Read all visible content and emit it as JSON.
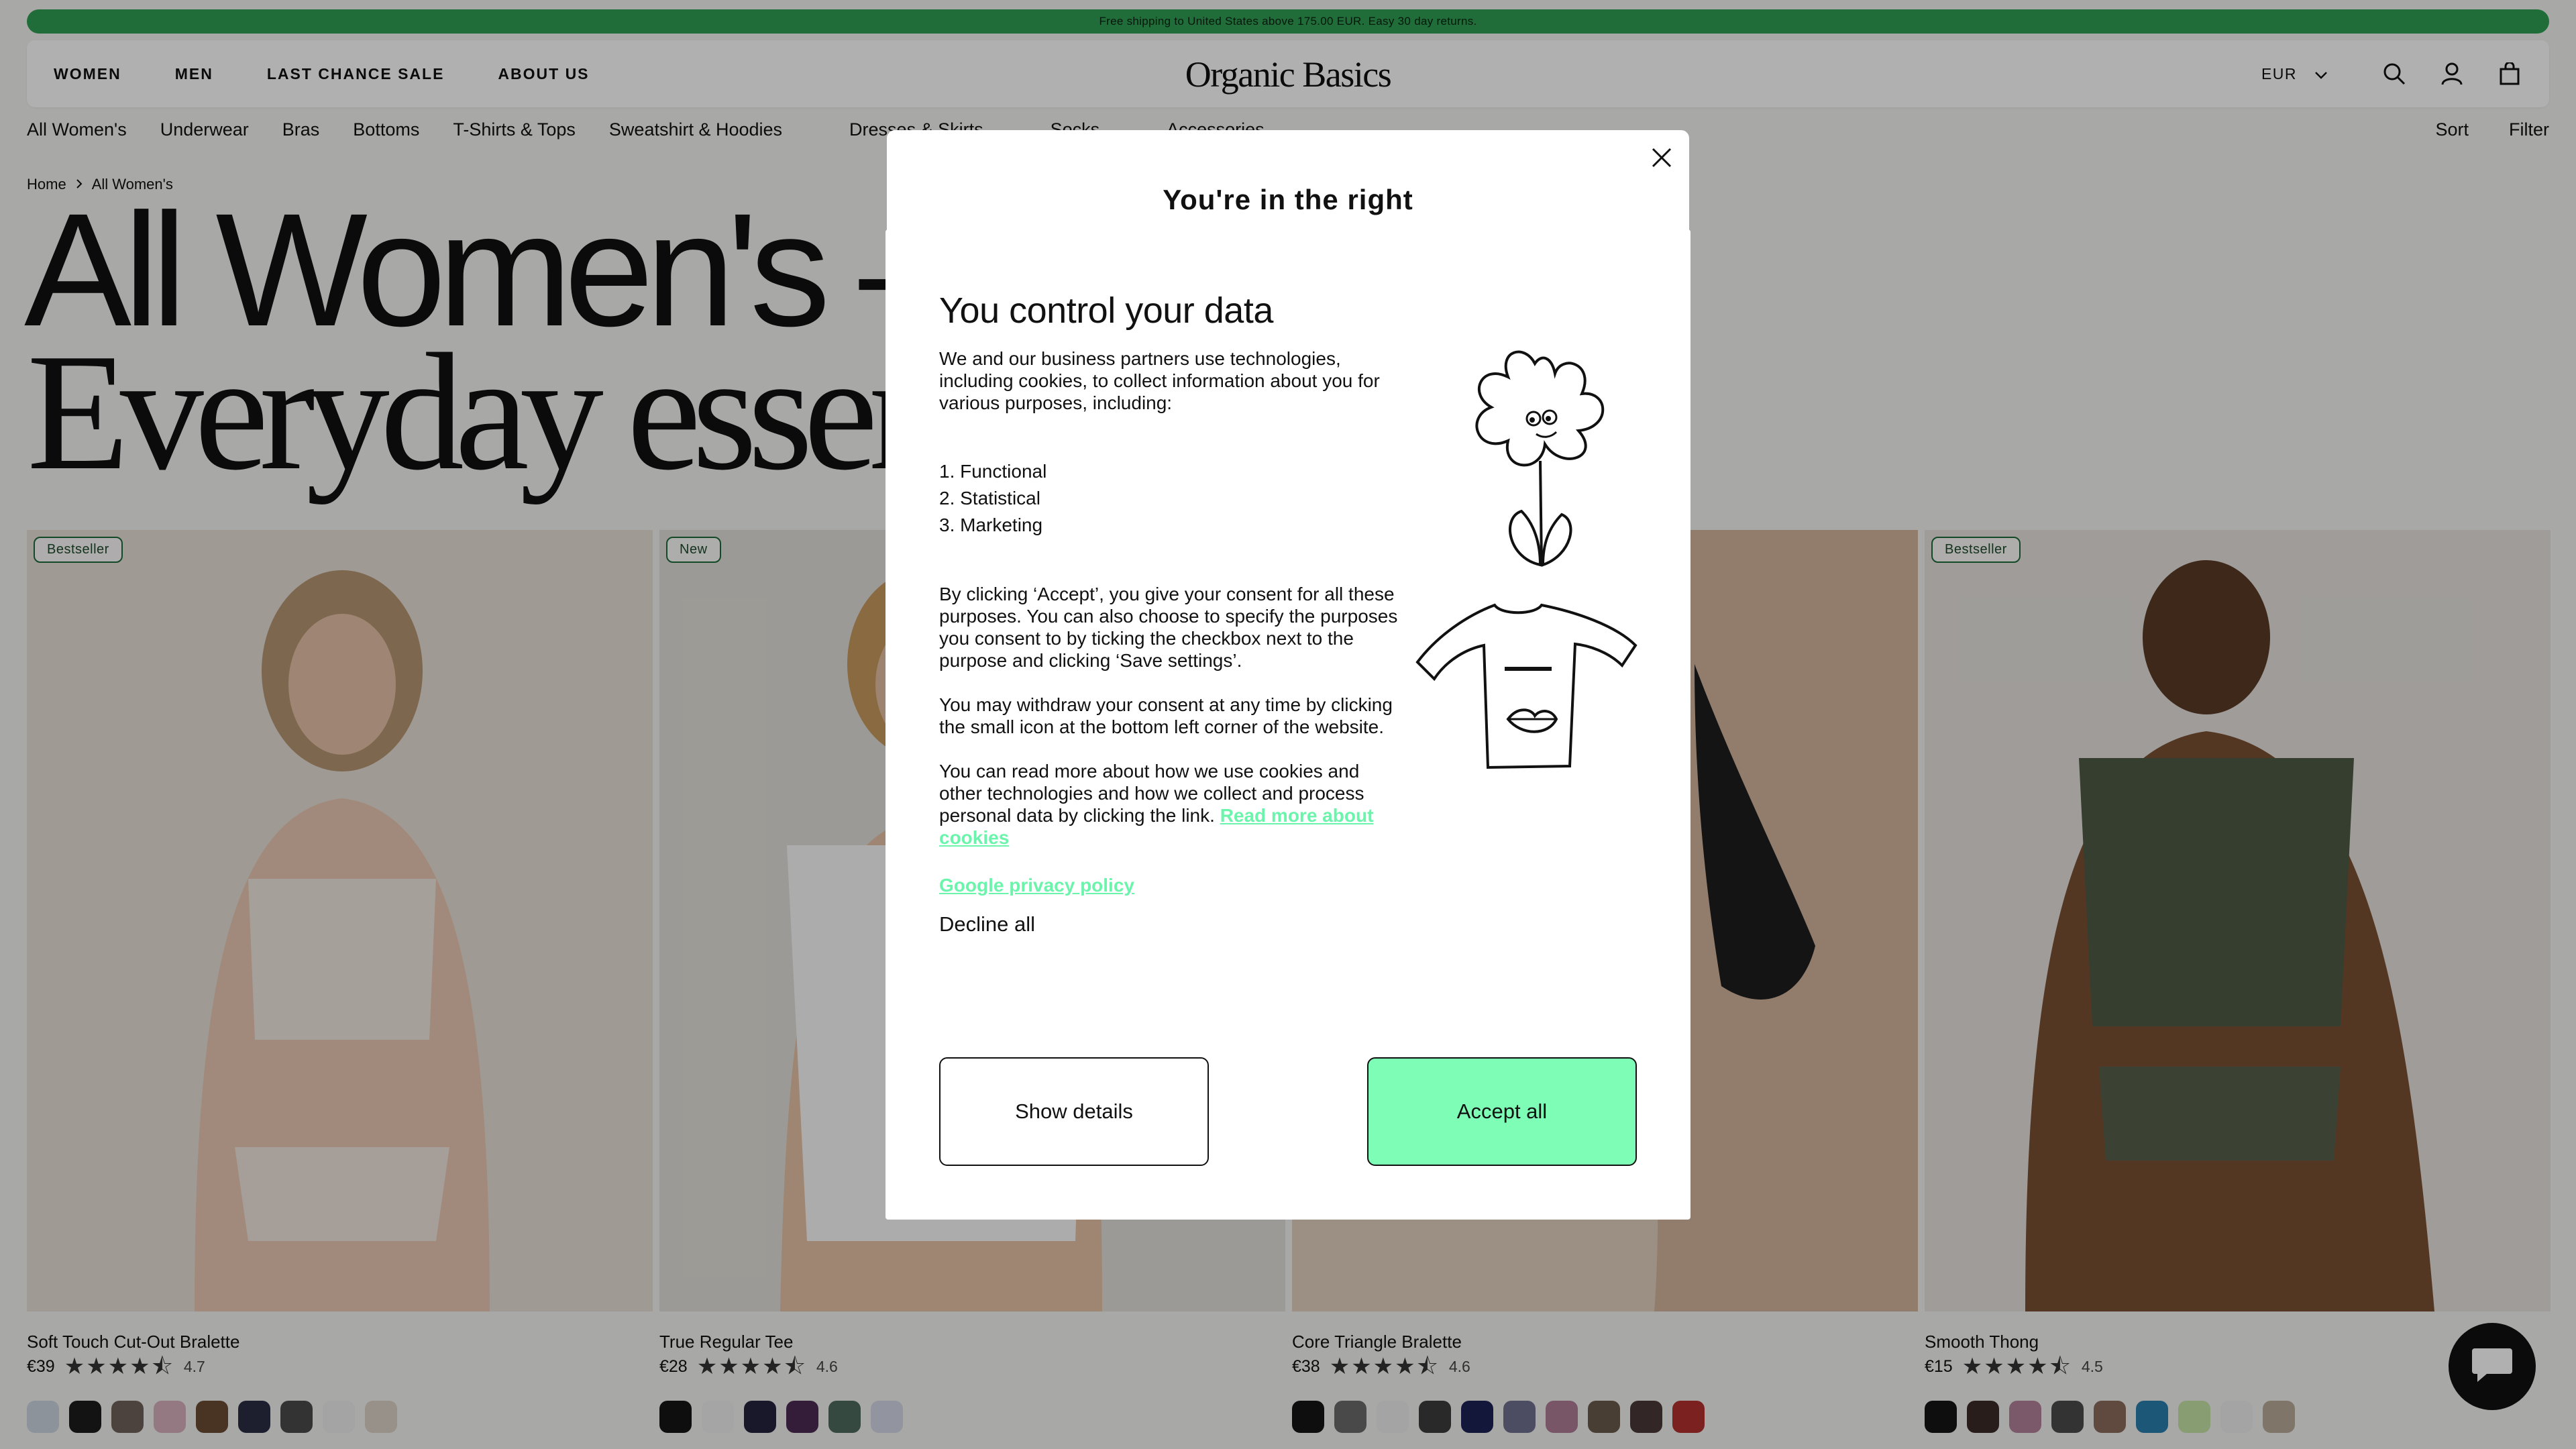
{
  "promo": {
    "text": "Free shipping to United States above 175.00 EUR. Easy 30 day returns."
  },
  "header": {
    "nav": [
      "WOMEN",
      "MEN",
      "LAST CHANCE SALE",
      "ABOUT US"
    ],
    "logo": "Organic Basics",
    "currency": "EUR"
  },
  "categories": [
    "All Women's",
    "Underwear",
    "Bras",
    "Bottoms",
    "T-Shirts & Tops",
    "Sweatshirt & Hoodies",
    "Dresses & Skirts",
    "Socks",
    "Accessories"
  ],
  "controls": {
    "sort": "Sort",
    "filter": "Filter"
  },
  "breadcrumb": {
    "home": "Home",
    "current": "All Women's"
  },
  "hero": {
    "line1": "All Women's  —",
    "line2": "Everyday essentia"
  },
  "products": [
    {
      "badge": "Bestseller",
      "name": "Soft Touch Cut-Out Bralette",
      "price": "€39",
      "rating": "4.7",
      "photo_bg": "#e7dfd6",
      "swatches": [
        "#cdd6df",
        "#1c1c1c",
        "#6e625a",
        "#d7aebd",
        "#6b4a33",
        "#2a2d45",
        "#4b4b4b",
        "#eeeeee",
        "#ddd2c8"
      ]
    },
    {
      "badge": "New",
      "name": "True Regular Tee",
      "price": "€28",
      "rating": "4.6",
      "photo_bg": "#e3e0da",
      "swatches": [
        "#151515",
        "#efefef",
        "#24243d",
        "#4a2a52",
        "#4f6b5d",
        "#d4d8e6"
      ]
    },
    {
      "badge": "",
      "name": "Core Triangle Bralette",
      "price": "€38",
      "rating": "4.6",
      "photo_bg": "#d8c3b0",
      "swatches": [
        "#151515",
        "#6b6b6b",
        "#eeeeee",
        "#3c3c3c",
        "#1c2455",
        "#6f6f8e",
        "#b07b97",
        "#6b5a4b",
        "#4b3838",
        "#b3302f"
      ]
    },
    {
      "badge": "Bestseller",
      "name": "Smooth Thong",
      "price": "€15",
      "rating": "4.5",
      "photo_bg": "#e6e3de",
      "swatches": [
        "#151515",
        "#3a2a28",
        "#b4809b",
        "#4b4b4b",
        "#8c6b5b",
        "#2a7fae",
        "#c6e4a6",
        "#eeeeee",
        "#b8ab98"
      ]
    }
  ],
  "under_popup": {
    "title": "You're in the right"
  },
  "consent": {
    "title": "You control your data",
    "intro": "We and our business partners use technologies, including cookies, to collect information about you for various purposes, including:",
    "purposes": [
      "1. Functional",
      "2. Statistical",
      "3. Marketing"
    ],
    "consent_text": "By clicking ‘Accept’, you give your consent for all these purposes. You can also choose to specify the purposes you consent to by ticking the checkbox next to the purpose and clicking ‘Save settings’.",
    "withdraw_text": "You may withdraw your consent at any time by clicking the small icon at the bottom left corner of the website.",
    "readmore_text": "You can read more about how we use cookies and other technologies and how we collect and process personal data by clicking the link.",
    "readmore_link": "Read more about cookies",
    "google_link": "Google privacy policy",
    "decline": "Decline all",
    "show_details": "Show details",
    "accept_all": "Accept all",
    "accent_color": "#7dfdb5"
  }
}
